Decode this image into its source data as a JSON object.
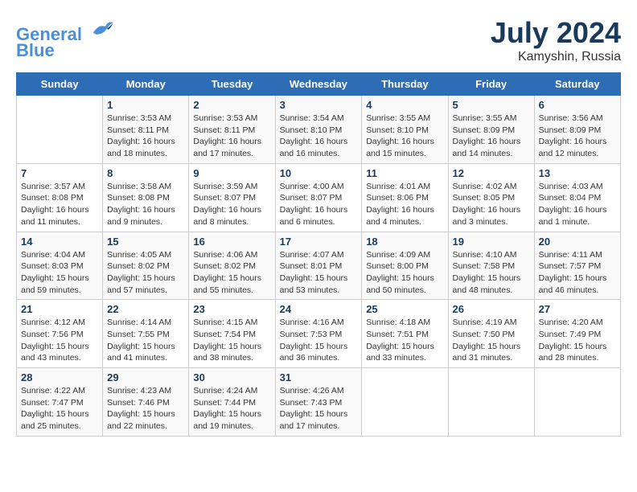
{
  "header": {
    "logo_line1": "General",
    "logo_line2": "Blue",
    "month_year": "July 2024",
    "location": "Kamyshin, Russia"
  },
  "days_of_week": [
    "Sunday",
    "Monday",
    "Tuesday",
    "Wednesday",
    "Thursday",
    "Friday",
    "Saturday"
  ],
  "weeks": [
    [
      {
        "day": "",
        "info": ""
      },
      {
        "day": "1",
        "info": "Sunrise: 3:53 AM\nSunset: 8:11 PM\nDaylight: 16 hours\nand 18 minutes."
      },
      {
        "day": "2",
        "info": "Sunrise: 3:53 AM\nSunset: 8:11 PM\nDaylight: 16 hours\nand 17 minutes."
      },
      {
        "day": "3",
        "info": "Sunrise: 3:54 AM\nSunset: 8:10 PM\nDaylight: 16 hours\nand 16 minutes."
      },
      {
        "day": "4",
        "info": "Sunrise: 3:55 AM\nSunset: 8:10 PM\nDaylight: 16 hours\nand 15 minutes."
      },
      {
        "day": "5",
        "info": "Sunrise: 3:55 AM\nSunset: 8:09 PM\nDaylight: 16 hours\nand 14 minutes."
      },
      {
        "day": "6",
        "info": "Sunrise: 3:56 AM\nSunset: 8:09 PM\nDaylight: 16 hours\nand 12 minutes."
      }
    ],
    [
      {
        "day": "7",
        "info": "Sunrise: 3:57 AM\nSunset: 8:08 PM\nDaylight: 16 hours\nand 11 minutes."
      },
      {
        "day": "8",
        "info": "Sunrise: 3:58 AM\nSunset: 8:08 PM\nDaylight: 16 hours\nand 9 minutes."
      },
      {
        "day": "9",
        "info": "Sunrise: 3:59 AM\nSunset: 8:07 PM\nDaylight: 16 hours\nand 8 minutes."
      },
      {
        "day": "10",
        "info": "Sunrise: 4:00 AM\nSunset: 8:07 PM\nDaylight: 16 hours\nand 6 minutes."
      },
      {
        "day": "11",
        "info": "Sunrise: 4:01 AM\nSunset: 8:06 PM\nDaylight: 16 hours\nand 4 minutes."
      },
      {
        "day": "12",
        "info": "Sunrise: 4:02 AM\nSunset: 8:05 PM\nDaylight: 16 hours\nand 3 minutes."
      },
      {
        "day": "13",
        "info": "Sunrise: 4:03 AM\nSunset: 8:04 PM\nDaylight: 16 hours\nand 1 minute."
      }
    ],
    [
      {
        "day": "14",
        "info": "Sunrise: 4:04 AM\nSunset: 8:03 PM\nDaylight: 15 hours\nand 59 minutes."
      },
      {
        "day": "15",
        "info": "Sunrise: 4:05 AM\nSunset: 8:02 PM\nDaylight: 15 hours\nand 57 minutes."
      },
      {
        "day": "16",
        "info": "Sunrise: 4:06 AM\nSunset: 8:02 PM\nDaylight: 15 hours\nand 55 minutes."
      },
      {
        "day": "17",
        "info": "Sunrise: 4:07 AM\nSunset: 8:01 PM\nDaylight: 15 hours\nand 53 minutes."
      },
      {
        "day": "18",
        "info": "Sunrise: 4:09 AM\nSunset: 8:00 PM\nDaylight: 15 hours\nand 50 minutes."
      },
      {
        "day": "19",
        "info": "Sunrise: 4:10 AM\nSunset: 7:58 PM\nDaylight: 15 hours\nand 48 minutes."
      },
      {
        "day": "20",
        "info": "Sunrise: 4:11 AM\nSunset: 7:57 PM\nDaylight: 15 hours\nand 46 minutes."
      }
    ],
    [
      {
        "day": "21",
        "info": "Sunrise: 4:12 AM\nSunset: 7:56 PM\nDaylight: 15 hours\nand 43 minutes."
      },
      {
        "day": "22",
        "info": "Sunrise: 4:14 AM\nSunset: 7:55 PM\nDaylight: 15 hours\nand 41 minutes."
      },
      {
        "day": "23",
        "info": "Sunrise: 4:15 AM\nSunset: 7:54 PM\nDaylight: 15 hours\nand 38 minutes."
      },
      {
        "day": "24",
        "info": "Sunrise: 4:16 AM\nSunset: 7:53 PM\nDaylight: 15 hours\nand 36 minutes."
      },
      {
        "day": "25",
        "info": "Sunrise: 4:18 AM\nSunset: 7:51 PM\nDaylight: 15 hours\nand 33 minutes."
      },
      {
        "day": "26",
        "info": "Sunrise: 4:19 AM\nSunset: 7:50 PM\nDaylight: 15 hours\nand 31 minutes."
      },
      {
        "day": "27",
        "info": "Sunrise: 4:20 AM\nSunset: 7:49 PM\nDaylight: 15 hours\nand 28 minutes."
      }
    ],
    [
      {
        "day": "28",
        "info": "Sunrise: 4:22 AM\nSunset: 7:47 PM\nDaylight: 15 hours\nand 25 minutes."
      },
      {
        "day": "29",
        "info": "Sunrise: 4:23 AM\nSunset: 7:46 PM\nDaylight: 15 hours\nand 22 minutes."
      },
      {
        "day": "30",
        "info": "Sunrise: 4:24 AM\nSunset: 7:44 PM\nDaylight: 15 hours\nand 19 minutes."
      },
      {
        "day": "31",
        "info": "Sunrise: 4:26 AM\nSunset: 7:43 PM\nDaylight: 15 hours\nand 17 minutes."
      },
      {
        "day": "",
        "info": ""
      },
      {
        "day": "",
        "info": ""
      },
      {
        "day": "",
        "info": ""
      }
    ]
  ]
}
